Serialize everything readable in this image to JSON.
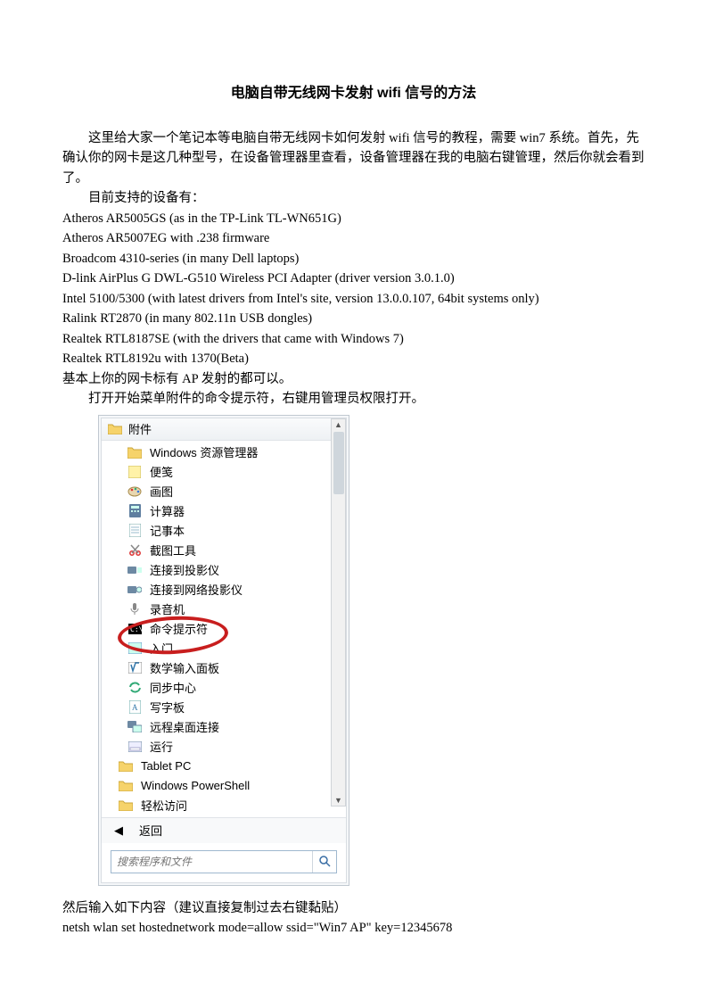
{
  "title": "电脑自带无线网卡发射 wifi 信号的方法",
  "intro": {
    "p1": "这里给大家一个笔记本等电脑自带无线网卡如何发射 wifi 信号的教程，需要 win7 系统。首先，先确认你的网卡是这几种型号，在设备管理器里查看，设备管理器在我的电脑右键管理，然后你就会看到了。",
    "p2": "目前支持的设备有："
  },
  "devices": [
    "Atheros AR5005GS (as in the TP-Link TL-WN651G)",
    "Atheros AR5007EG with .238 firmware",
    "Broadcom 4310-series (in many Dell laptops)",
    "D-link AirPlus G DWL-G510 Wireless PCI Adapter (driver version 3.0.1.0)",
    "Intel 5100/5300 (with latest drivers from Intel's site, version 13.0.0.107, 64bit systems only)",
    "Ralink RT2870 (in many 802.11n USB dongles)",
    "Realtek RTL8187SE (with the drivers that came with Windows 7)",
    "Realtek RTL8192u with 1370(Beta)"
  ],
  "note_ap": "基本上你的网卡标有 AP 发射的都可以。",
  "open_cmd": "打开开始菜单附件的命令提示符，右键用管理员权限打开。",
  "menu": {
    "folder": "附件",
    "items": [
      "Windows 资源管理器",
      "便笺",
      "画图",
      "计算器",
      "记事本",
      "截图工具",
      "连接到投影仪",
      "连接到网络投影仪",
      "录音机",
      "命令提示符",
      "入门",
      "数学输入面板",
      "同步中心",
      "写字板",
      "远程桌面连接",
      "运行"
    ],
    "subfolders": [
      "Tablet PC",
      "Windows PowerShell",
      "轻松访问"
    ],
    "back": "返回",
    "search_placeholder": "搜索程序和文件"
  },
  "after": {
    "p1": "然后输入如下内容（建议直接复制过去右键黏贴）",
    "p2": "netsh wlan set hostednetwork mode=allow ssid=\"Win7 AP\" key=12345678"
  }
}
